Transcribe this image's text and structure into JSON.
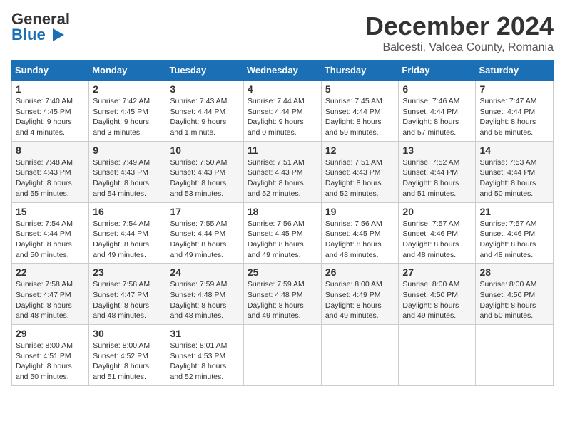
{
  "header": {
    "logo_line1": "General",
    "logo_line2": "Blue",
    "month": "December 2024",
    "location": "Balcesti, Valcea County, Romania"
  },
  "weekdays": [
    "Sunday",
    "Monday",
    "Tuesday",
    "Wednesday",
    "Thursday",
    "Friday",
    "Saturday"
  ],
  "weeks": [
    [
      {
        "day": "1",
        "sunrise": "7:40 AM",
        "sunset": "4:45 PM",
        "daylight": "9 hours and 4 minutes."
      },
      {
        "day": "2",
        "sunrise": "7:42 AM",
        "sunset": "4:45 PM",
        "daylight": "9 hours and 3 minutes."
      },
      {
        "day": "3",
        "sunrise": "7:43 AM",
        "sunset": "4:44 PM",
        "daylight": "9 hours and 1 minute."
      },
      {
        "day": "4",
        "sunrise": "7:44 AM",
        "sunset": "4:44 PM",
        "daylight": "9 hours and 0 minutes."
      },
      {
        "day": "5",
        "sunrise": "7:45 AM",
        "sunset": "4:44 PM",
        "daylight": "8 hours and 59 minutes."
      },
      {
        "day": "6",
        "sunrise": "7:46 AM",
        "sunset": "4:44 PM",
        "daylight": "8 hours and 57 minutes."
      },
      {
        "day": "7",
        "sunrise": "7:47 AM",
        "sunset": "4:44 PM",
        "daylight": "8 hours and 56 minutes."
      }
    ],
    [
      {
        "day": "8",
        "sunrise": "7:48 AM",
        "sunset": "4:43 PM",
        "daylight": "8 hours and 55 minutes."
      },
      {
        "day": "9",
        "sunrise": "7:49 AM",
        "sunset": "4:43 PM",
        "daylight": "8 hours and 54 minutes."
      },
      {
        "day": "10",
        "sunrise": "7:50 AM",
        "sunset": "4:43 PM",
        "daylight": "8 hours and 53 minutes."
      },
      {
        "day": "11",
        "sunrise": "7:51 AM",
        "sunset": "4:43 PM",
        "daylight": "8 hours and 52 minutes."
      },
      {
        "day": "12",
        "sunrise": "7:51 AM",
        "sunset": "4:43 PM",
        "daylight": "8 hours and 52 minutes."
      },
      {
        "day": "13",
        "sunrise": "7:52 AM",
        "sunset": "4:44 PM",
        "daylight": "8 hours and 51 minutes."
      },
      {
        "day": "14",
        "sunrise": "7:53 AM",
        "sunset": "4:44 PM",
        "daylight": "8 hours and 50 minutes."
      }
    ],
    [
      {
        "day": "15",
        "sunrise": "7:54 AM",
        "sunset": "4:44 PM",
        "daylight": "8 hours and 50 minutes."
      },
      {
        "day": "16",
        "sunrise": "7:54 AM",
        "sunset": "4:44 PM",
        "daylight": "8 hours and 49 minutes."
      },
      {
        "day": "17",
        "sunrise": "7:55 AM",
        "sunset": "4:44 PM",
        "daylight": "8 hours and 49 minutes."
      },
      {
        "day": "18",
        "sunrise": "7:56 AM",
        "sunset": "4:45 PM",
        "daylight": "8 hours and 49 minutes."
      },
      {
        "day": "19",
        "sunrise": "7:56 AM",
        "sunset": "4:45 PM",
        "daylight": "8 hours and 48 minutes."
      },
      {
        "day": "20",
        "sunrise": "7:57 AM",
        "sunset": "4:46 PM",
        "daylight": "8 hours and 48 minutes."
      },
      {
        "day": "21",
        "sunrise": "7:57 AM",
        "sunset": "4:46 PM",
        "daylight": "8 hours and 48 minutes."
      }
    ],
    [
      {
        "day": "22",
        "sunrise": "7:58 AM",
        "sunset": "4:47 PM",
        "daylight": "8 hours and 48 minutes."
      },
      {
        "day": "23",
        "sunrise": "7:58 AM",
        "sunset": "4:47 PM",
        "daylight": "8 hours and 48 minutes."
      },
      {
        "day": "24",
        "sunrise": "7:59 AM",
        "sunset": "4:48 PM",
        "daylight": "8 hours and 48 minutes."
      },
      {
        "day": "25",
        "sunrise": "7:59 AM",
        "sunset": "4:48 PM",
        "daylight": "8 hours and 49 minutes."
      },
      {
        "day": "26",
        "sunrise": "8:00 AM",
        "sunset": "4:49 PM",
        "daylight": "8 hours and 49 minutes."
      },
      {
        "day": "27",
        "sunrise": "8:00 AM",
        "sunset": "4:50 PM",
        "daylight": "8 hours and 49 minutes."
      },
      {
        "day": "28",
        "sunrise": "8:00 AM",
        "sunset": "4:50 PM",
        "daylight": "8 hours and 50 minutes."
      }
    ],
    [
      {
        "day": "29",
        "sunrise": "8:00 AM",
        "sunset": "4:51 PM",
        "daylight": "8 hours and 50 minutes."
      },
      {
        "day": "30",
        "sunrise": "8:00 AM",
        "sunset": "4:52 PM",
        "daylight": "8 hours and 51 minutes."
      },
      {
        "day": "31",
        "sunrise": "8:01 AM",
        "sunset": "4:53 PM",
        "daylight": "8 hours and 52 minutes."
      },
      null,
      null,
      null,
      null
    ]
  ]
}
